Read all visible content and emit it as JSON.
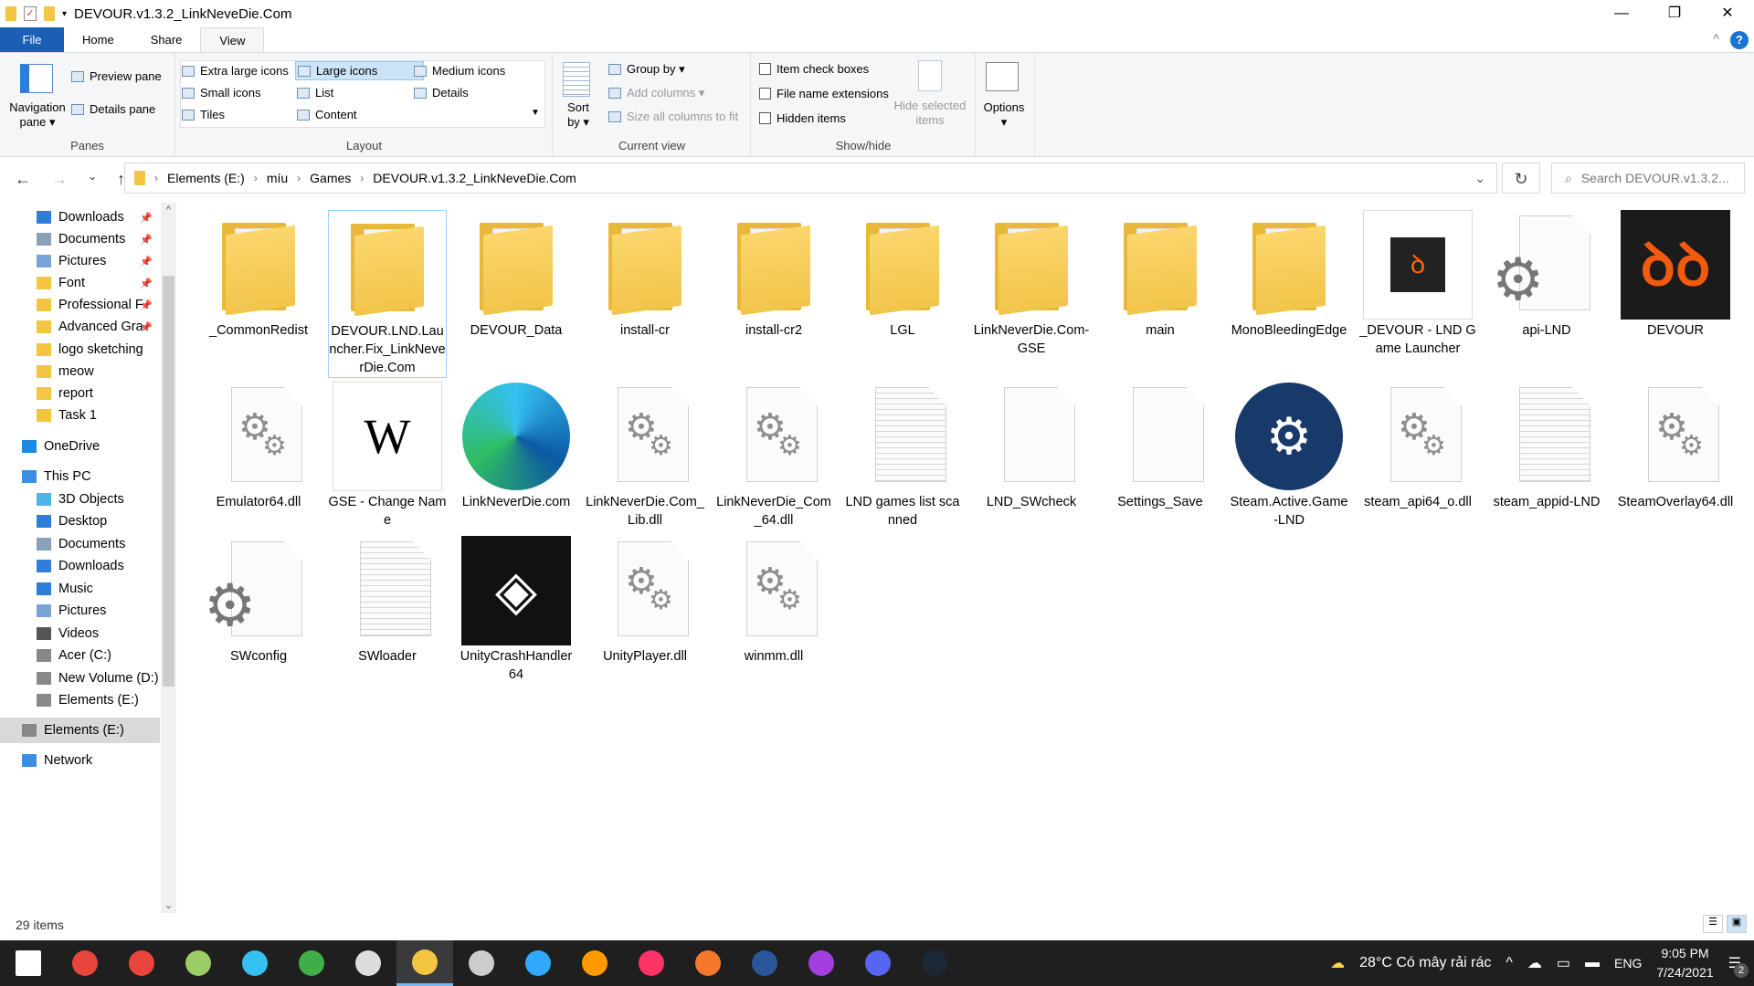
{
  "window": {
    "title": "DEVOUR.v1.3.2_LinkNeveDie.Com",
    "minimize": "—",
    "maximize": "❐",
    "close": "✕"
  },
  "tabs": [
    "File",
    "Home",
    "Share",
    "View"
  ],
  "ribbon": {
    "panes": {
      "label": "Panes",
      "navigation": "Navigation pane ▾",
      "preview": "Preview pane",
      "details": "Details pane"
    },
    "layout": {
      "label": "Layout",
      "items": [
        "Extra large icons",
        "Large icons",
        "Medium icons",
        "Small icons",
        "List",
        "Details",
        "Tiles",
        "Content"
      ],
      "selected": "Large icons"
    },
    "current_view": {
      "label": "Current view",
      "sort": "Sort by ▾",
      "group": "Group by ▾",
      "add_columns": "Add columns ▾",
      "size_columns": "Size all columns to fit"
    },
    "show_hide": {
      "label": "Show/hide",
      "item_check": "Item check boxes",
      "extensions": "File name extensions",
      "hidden": "Hidden items",
      "hide_selected": "Hide selected items"
    },
    "options": "Options ▾"
  },
  "address": {
    "crumbs": [
      "Elements (E:)",
      "míu",
      "Games",
      "DEVOUR.v1.3.2_LinkNeveDie.Com"
    ],
    "search_placeholder": "Search DEVOUR.v1.3.2..."
  },
  "sidebar": [
    {
      "label": "Downloads",
      "pin": true,
      "icon": "download"
    },
    {
      "label": "Documents",
      "pin": true,
      "icon": "documents"
    },
    {
      "label": "Pictures",
      "pin": true,
      "icon": "pictures"
    },
    {
      "label": "Font",
      "pin": true,
      "icon": "folder"
    },
    {
      "label": "Professional F",
      "pin": true,
      "icon": "folder"
    },
    {
      "label": "Advanced Gra",
      "pin": true,
      "icon": "folder"
    },
    {
      "label": "logo sketching",
      "pin": false,
      "icon": "folder"
    },
    {
      "label": "meow",
      "pin": false,
      "icon": "folder"
    },
    {
      "label": "report",
      "pin": false,
      "icon": "folder"
    },
    {
      "label": "Task 1",
      "pin": false,
      "icon": "folder"
    },
    {
      "label": "OneDrive",
      "icon": "cloud"
    },
    {
      "label": "This PC",
      "icon": "pc"
    },
    {
      "label": "3D Objects",
      "icon": "3d"
    },
    {
      "label": "Desktop",
      "icon": "desktop"
    },
    {
      "label": "Documents",
      "icon": "documents"
    },
    {
      "label": "Downloads",
      "icon": "download"
    },
    {
      "label": "Music",
      "icon": "music"
    },
    {
      "label": "Pictures",
      "icon": "pictures"
    },
    {
      "label": "Videos",
      "icon": "videos"
    },
    {
      "label": "Acer (C:)",
      "icon": "drive"
    },
    {
      "label": "New Volume (D:)",
      "icon": "drive"
    },
    {
      "label": "Elements (E:)",
      "icon": "drive"
    },
    {
      "label": "Elements (E:)",
      "icon": "drive"
    },
    {
      "label": "Network",
      "icon": "network"
    }
  ],
  "files": [
    {
      "name": "_CommonRedist",
      "type": "folder"
    },
    {
      "name": "DEVOUR.LND.Launcher.Fix_LinkNeverDie.Com",
      "type": "folder"
    },
    {
      "name": "DEVOUR_Data",
      "type": "folder"
    },
    {
      "name": "install-cr",
      "type": "folder"
    },
    {
      "name": "install-cr2",
      "type": "folder"
    },
    {
      "name": "LGL",
      "type": "folder"
    },
    {
      "name": "LinkNeverDie.Com-GSE",
      "type": "folder"
    },
    {
      "name": "main",
      "type": "folder"
    },
    {
      "name": "MonoBleedingEdge",
      "type": "folder"
    },
    {
      "name": "_DEVOUR - LND Game Launcher",
      "type": "launcher"
    },
    {
      "name": "api-LND",
      "type": "config"
    },
    {
      "name": "DEVOUR",
      "type": "devour"
    },
    {
      "name": "Emulator64.dll",
      "type": "dll"
    },
    {
      "name": "GSE - Change Name",
      "type": "gse"
    },
    {
      "name": "LinkNeverDie.com",
      "type": "edge"
    },
    {
      "name": "LinkNeverDie.Com_Lib.dll",
      "type": "dll"
    },
    {
      "name": "LinkNeverDie_Com_64.dll",
      "type": "dll"
    },
    {
      "name": "LND games list scanned",
      "type": "text"
    },
    {
      "name": "LND_SWcheck",
      "type": "blank"
    },
    {
      "name": "Settings_Save",
      "type": "blank"
    },
    {
      "name": "Steam.Active.Game-LND",
      "type": "steam"
    },
    {
      "name": "steam_api64_o.dll",
      "type": "dll"
    },
    {
      "name": "steam_appid-LND",
      "type": "text"
    },
    {
      "name": "SteamOverlay64.dll",
      "type": "dll"
    },
    {
      "name": "SWconfig",
      "type": "config"
    },
    {
      "name": "SWloader",
      "type": "text"
    },
    {
      "name": "UnityCrashHandler64",
      "type": "unity"
    },
    {
      "name": "UnityPlayer.dll",
      "type": "dll"
    },
    {
      "name": "winmm.dll",
      "type": "dll"
    }
  ],
  "status": {
    "count": "29 items"
  },
  "taskbar": {
    "apps": [
      "Start",
      "Chrome",
      "Chrome",
      "Chrome Canary",
      "Edge",
      "App",
      "App",
      "File Explorer",
      "App",
      "Ps",
      "Ai",
      "Id",
      "Blender",
      "W",
      "Messenger",
      "Discord",
      "Steam"
    ],
    "weather": "28°C  Có mây rải rác",
    "lang": "ENG",
    "time": "9:05 PM",
    "date": "7/24/2021",
    "notifications": "2"
  }
}
